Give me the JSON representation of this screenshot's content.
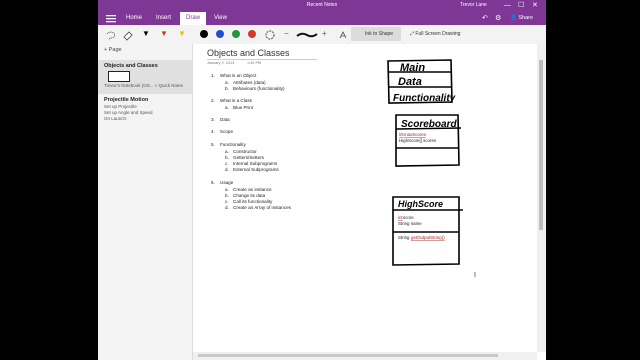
{
  "window": {
    "title": "Recent Notes",
    "user": "Trevor Lane",
    "controls": [
      "—",
      "☐",
      "✕"
    ]
  },
  "tabs": [
    {
      "label": "Home"
    },
    {
      "label": "Insert"
    },
    {
      "label": "Draw"
    },
    {
      "label": "View"
    }
  ],
  "header_actions": {
    "share": "Share"
  },
  "ribbon": {
    "ink_to_shape": "Ink to Shape",
    "full_screen": "Full Screen Drawing",
    "pen_colors": [
      "#000000",
      "#1f4fcf",
      "#1e9a3a",
      "#d43a2a"
    ]
  },
  "sidebar": {
    "add_page": "+ Page",
    "pages": [
      {
        "title": "Objects and Classes",
        "subtitle": "Trevor's Notebook (OS... » Quick Notes"
      },
      {
        "title": "Projectile Motion",
        "lines": [
          "Set up Projectile",
          "Set up Angle and Speed",
          "On Launch:"
        ]
      }
    ]
  },
  "page": {
    "title": "Objects and Classes",
    "date": "January 2, 2013",
    "time": "1:49 PM",
    "outline": [
      {
        "num": "1.",
        "text": "What is an Object",
        "subs": [
          {
            "num": "a.",
            "text": "Attributes (data)"
          },
          {
            "num": "b.",
            "text": "Behaviours (functionality)"
          }
        ]
      },
      {
        "num": "2.",
        "text": "What is a Class",
        "subs": [
          {
            "num": "a.",
            "text": "Blue Print"
          }
        ]
      },
      {
        "num": "3.",
        "text": "Data",
        "subs": []
      },
      {
        "num": "4.",
        "text": "Scope",
        "subs": []
      },
      {
        "num": "5.",
        "text": "Functionality",
        "subs": [
          {
            "num": "a.",
            "text": "Constructor"
          },
          {
            "num": "b.",
            "text": "Getters/Setters"
          },
          {
            "num": "c.",
            "text": "Internal Subprograms"
          },
          {
            "num": "d.",
            "text": "External Subprograms"
          }
        ]
      },
      {
        "num": "6.",
        "text": "Usage",
        "subs": [
          {
            "num": "a.",
            "text": "Create an instance"
          },
          {
            "num": "b.",
            "text": "Change its data"
          },
          {
            "num": "c.",
            "text": "Call its functionality"
          },
          {
            "num": "d.",
            "text": "Create an Array of instances"
          }
        ]
      }
    ]
  },
  "drawings": {
    "box1": [
      "Main",
      "Data",
      "Functionality"
    ],
    "box2": {
      "title": "Scoreboard",
      "line1_type": "int",
      "line1_name": "maxScores",
      "line2": "HighScore[] scores"
    },
    "box3": {
      "title": "HighScore",
      "line1_type": "int",
      "line1_name": "score",
      "line2": "String name",
      "line3_prefix": "String",
      "line3_method": "getOutputString()"
    }
  }
}
